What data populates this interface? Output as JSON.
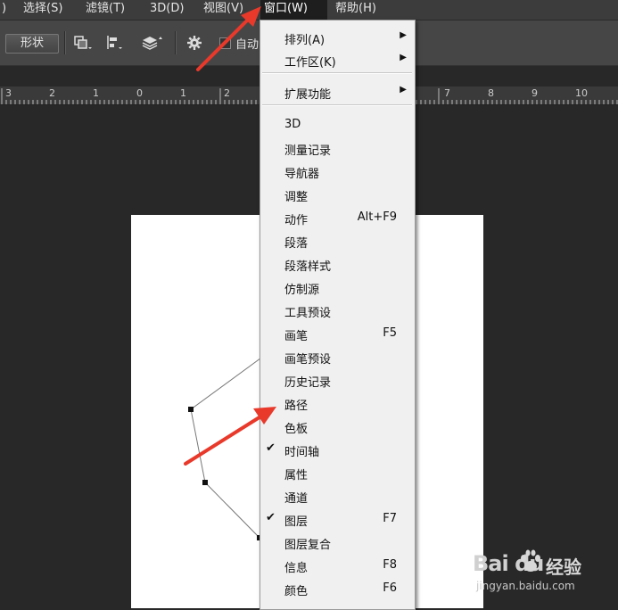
{
  "menubar": {
    "items": [
      {
        "label": ")"
      },
      {
        "label": "选择(S)"
      },
      {
        "label": "滤镜(T)"
      },
      {
        "label": "3D(D)"
      },
      {
        "label": "视图(V)"
      },
      {
        "label": "窗口(W)"
      },
      {
        "label": "帮助(H)"
      }
    ]
  },
  "options_bar": {
    "shape_label": "形状",
    "auto_label": "自动"
  },
  "ruler": {
    "labels": [
      "3",
      "2",
      "1",
      "0",
      "1",
      "2",
      "7",
      "8",
      "9",
      "10"
    ]
  },
  "window_menu": {
    "items": [
      {
        "label": "排列(A)",
        "shortcut": "",
        "submenu": true,
        "checked": false
      },
      {
        "label": "工作区(K)",
        "shortcut": "",
        "submenu": true,
        "checked": false
      },
      {
        "label": "扩展功能",
        "shortcut": "",
        "submenu": true,
        "checked": false
      },
      {
        "label": "3D",
        "shortcut": "",
        "submenu": false,
        "checked": false
      },
      {
        "label": "测量记录",
        "shortcut": "",
        "submenu": false,
        "checked": false
      },
      {
        "label": "导航器",
        "shortcut": "",
        "submenu": false,
        "checked": false
      },
      {
        "label": "调整",
        "shortcut": "",
        "submenu": false,
        "checked": false
      },
      {
        "label": "动作",
        "shortcut": "Alt+F9",
        "submenu": false,
        "checked": false
      },
      {
        "label": "段落",
        "shortcut": "",
        "submenu": false,
        "checked": false
      },
      {
        "label": "段落样式",
        "shortcut": "",
        "submenu": false,
        "checked": false
      },
      {
        "label": "仿制源",
        "shortcut": "",
        "submenu": false,
        "checked": false
      },
      {
        "label": "工具预设",
        "shortcut": "",
        "submenu": false,
        "checked": false
      },
      {
        "label": "画笔",
        "shortcut": "F5",
        "submenu": false,
        "checked": false
      },
      {
        "label": "画笔预设",
        "shortcut": "",
        "submenu": false,
        "checked": false
      },
      {
        "label": "历史记录",
        "shortcut": "",
        "submenu": false,
        "checked": false
      },
      {
        "label": "路径",
        "shortcut": "",
        "submenu": false,
        "checked": false
      },
      {
        "label": "色板",
        "shortcut": "",
        "submenu": false,
        "checked": false
      },
      {
        "label": "时间轴",
        "shortcut": "",
        "submenu": false,
        "checked": true
      },
      {
        "label": "属性",
        "shortcut": "",
        "submenu": false,
        "checked": false
      },
      {
        "label": "通道",
        "shortcut": "",
        "submenu": false,
        "checked": false
      },
      {
        "label": "图层",
        "shortcut": "F7",
        "submenu": false,
        "checked": true
      },
      {
        "label": "图层复合",
        "shortcut": "",
        "submenu": false,
        "checked": false
      },
      {
        "label": "信息",
        "shortcut": "F8",
        "submenu": false,
        "checked": false
      },
      {
        "label": "颜色",
        "shortcut": "F6",
        "submenu": false,
        "checked": false
      }
    ]
  },
  "icons": {
    "submenu_arrow": "triangle-right-icon",
    "check": "checkmark-icon"
  },
  "colors": {
    "annotation_arrow": "#e8392b",
    "menu_bg": "#f0f0f0",
    "menubar_bg": "#3c3c3c"
  },
  "watermark": {
    "logo": "Bai du",
    "brand": "经验",
    "url": "jingyan.baidu.com"
  }
}
